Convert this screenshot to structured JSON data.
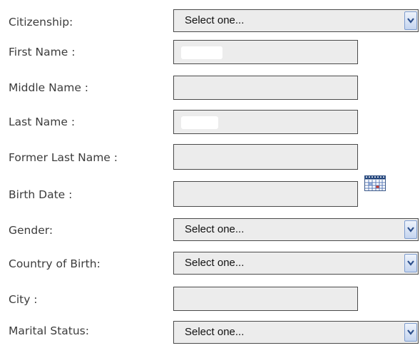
{
  "form": {
    "fields": [
      {
        "id": "citizenship",
        "label": "Citizenship:",
        "type": "select",
        "value": "Select one..."
      },
      {
        "id": "first-name",
        "label": "First Name :",
        "type": "text",
        "value": ""
      },
      {
        "id": "middle-name",
        "label": "Middle Name :",
        "type": "text",
        "value": ""
      },
      {
        "id": "last-name",
        "label": "Last Name :",
        "type": "text",
        "value": ""
      },
      {
        "id": "former-last-name",
        "label": "Former Last Name :",
        "type": "text",
        "value": ""
      },
      {
        "id": "birth-date",
        "label": "Birth Date :",
        "type": "date",
        "value": ""
      },
      {
        "id": "gender",
        "label": "Gender:",
        "type": "select",
        "value": "Select one..."
      },
      {
        "id": "country-of-birth",
        "label": "Country of Birth:",
        "type": "select",
        "value": "Select one..."
      },
      {
        "id": "city",
        "label": "City :",
        "type": "text",
        "value": ""
      },
      {
        "id": "marital-status",
        "label": "Marital Status:",
        "type": "select",
        "value": "Select one..."
      }
    ]
  },
  "icons": {
    "dropdown": "chevron-down-icon",
    "calendar": "calendar-icon"
  },
  "colors": {
    "label_text": "#3c3c3c",
    "field_background": "#ececec",
    "field_border": "#4a4a4a",
    "dropdown_accent": "#2c4f8c"
  }
}
